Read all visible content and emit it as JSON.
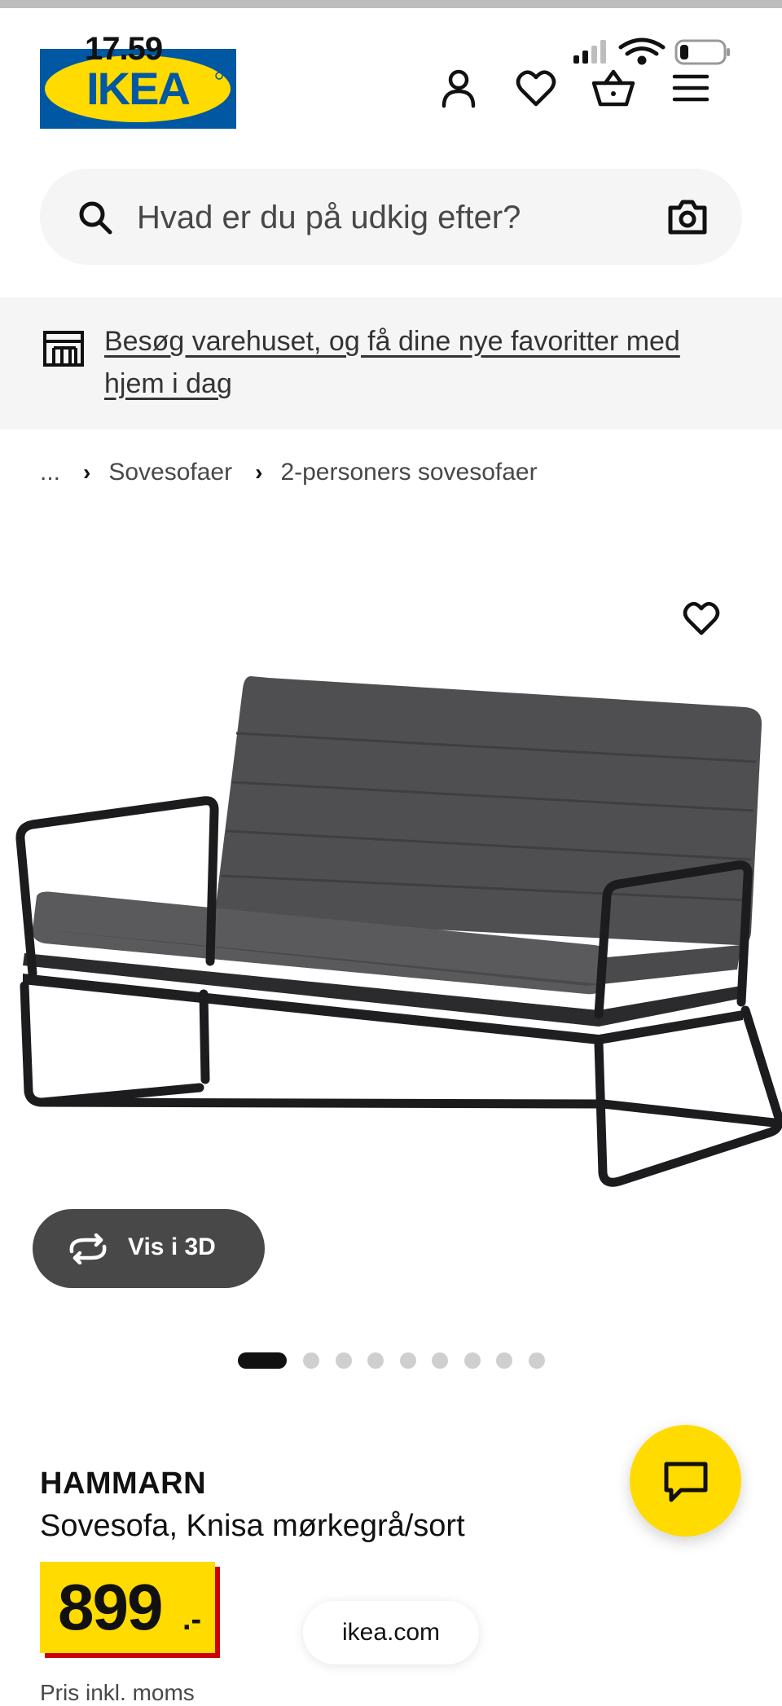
{
  "status_bar": {
    "time": "17.59"
  },
  "header": {
    "logo_text": "IKEA",
    "icons": [
      "account-icon",
      "heart-icon",
      "basket-icon",
      "menu-icon"
    ]
  },
  "search": {
    "placeholder": "Hvad er du på udkig efter?"
  },
  "store_banner": {
    "text": "Besøg varehuset, og få dine nye favoritter med hjem i dag"
  },
  "breadcrumb": {
    "ellipsis": "...",
    "level1": "Sovesofaer",
    "level2": "2-personers sovesofaer"
  },
  "gallery": {
    "view_3d_label": "Vis i 3D",
    "image_count": 9,
    "active_index": 0
  },
  "product": {
    "name": "HAMMARN",
    "description": "Sovesofa, Knisa mørkegrå/sort",
    "price": "899",
    "price_suffix": ".-",
    "price_note": "Pris inkl. moms"
  },
  "browser": {
    "url": "ikea.com"
  },
  "colors": {
    "ikea_blue": "#0058a3",
    "ikea_yellow": "#ffdb00",
    "price_shadow": "#cc0008"
  }
}
